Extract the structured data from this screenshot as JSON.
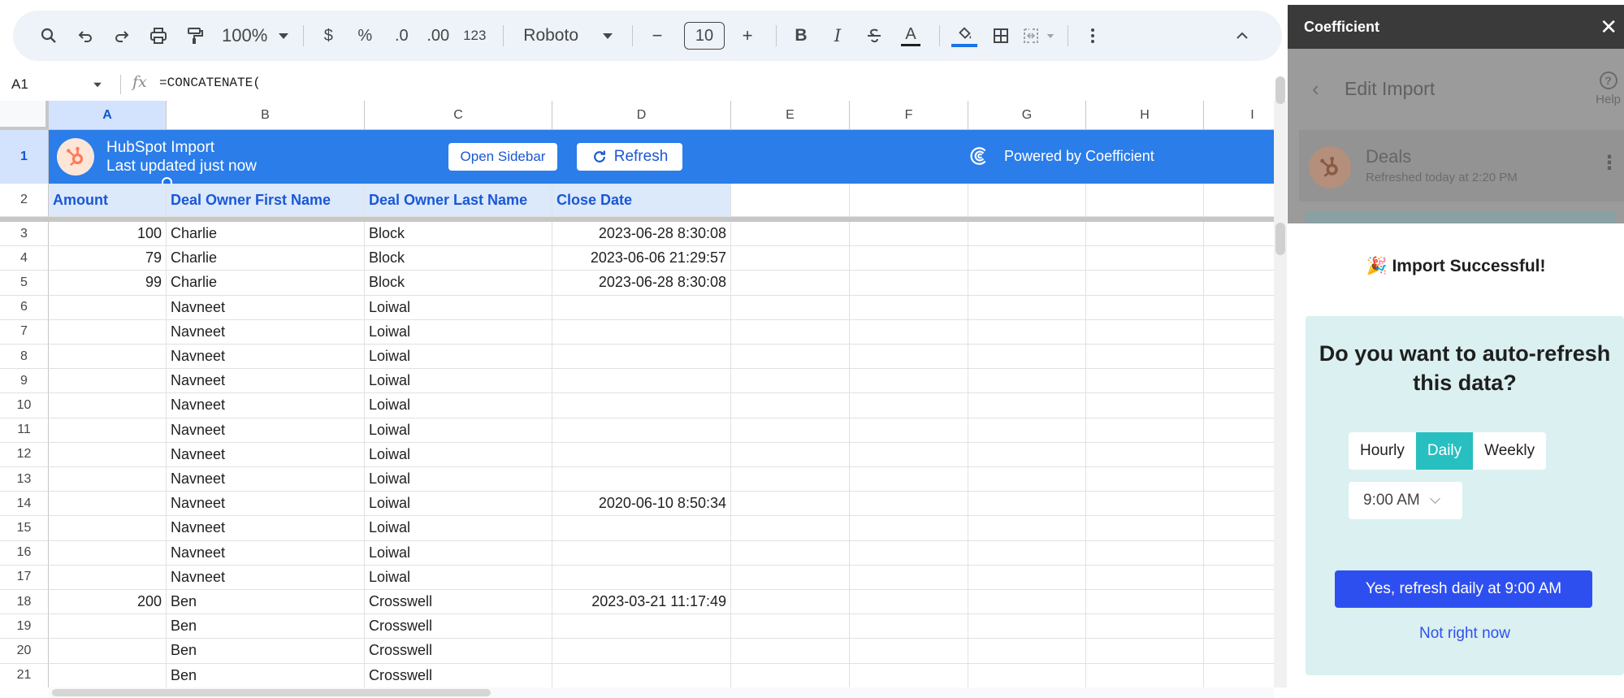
{
  "toolbar": {
    "zoom": "100%",
    "currency": "$",
    "percent": "%",
    "decrease_decimals": ".0",
    "increase_decimals": ".00",
    "more_formats": "123",
    "font": "Roboto",
    "font_size": "10",
    "minus": "−",
    "plus": "+",
    "bold": "B",
    "italic": "I",
    "text_color": "A"
  },
  "formula_bar": {
    "cell_ref": "A1",
    "fx": "fx",
    "formula": "=CONCATENATE("
  },
  "columns": [
    "A",
    "B",
    "C",
    "D",
    "E",
    "F",
    "G",
    "H",
    "I"
  ],
  "row_numbers": [
    "1",
    "2",
    "3",
    "4",
    "5",
    "6",
    "7",
    "8",
    "9",
    "10",
    "11",
    "12",
    "13",
    "14",
    "15",
    "16",
    "17",
    "18",
    "19",
    "20",
    "21"
  ],
  "banner": {
    "title": "HubSpot Import",
    "subtitle": "Last updated just now",
    "open_sidebar": "Open Sidebar",
    "refresh": "Refresh",
    "powered_by": "Powered by Coefficient"
  },
  "headers": [
    "Amount",
    "Deal Owner First Name",
    "Deal Owner Last Name",
    "Close Date"
  ],
  "rows": [
    [
      "100",
      "Charlie",
      "Block",
      "2023-06-28 8:30:08"
    ],
    [
      "79",
      "Charlie",
      "Block",
      "2023-06-06 21:29:57"
    ],
    [
      "99",
      "Charlie",
      "Block",
      "2023-06-28 8:30:08"
    ],
    [
      "",
      "Navneet",
      "Loiwal",
      ""
    ],
    [
      "",
      "Navneet",
      "Loiwal",
      ""
    ],
    [
      "",
      "Navneet",
      "Loiwal",
      ""
    ],
    [
      "",
      "Navneet",
      "Loiwal",
      ""
    ],
    [
      "",
      "Navneet",
      "Loiwal",
      ""
    ],
    [
      "",
      "Navneet",
      "Loiwal",
      ""
    ],
    [
      "",
      "Navneet",
      "Loiwal",
      ""
    ],
    [
      "",
      "Navneet",
      "Loiwal",
      ""
    ],
    [
      "",
      "Navneet",
      "Loiwal",
      "2020-06-10 8:50:34"
    ],
    [
      "",
      "Navneet",
      "Loiwal",
      ""
    ],
    [
      "",
      "Navneet",
      "Loiwal",
      ""
    ],
    [
      "",
      "Navneet",
      "Loiwal",
      ""
    ],
    [
      "200",
      "Ben",
      "Crosswell",
      "2023-03-21 11:17:49"
    ],
    [
      "",
      "Ben",
      "Crosswell",
      ""
    ],
    [
      "",
      "Ben",
      "Crosswell",
      ""
    ],
    [
      "",
      "Ben",
      "Crosswell",
      ""
    ]
  ],
  "panel": {
    "title": "Coefficient",
    "edit_import": "Edit Import",
    "help": "Help",
    "source_name": "Deals",
    "source_refreshed": "Refreshed today at 2:20 PM",
    "success": "🎉 Import Successful!",
    "question": "Do you want to auto-refresh this data?",
    "frequency_options": [
      "Hourly",
      "Daily",
      "Weekly"
    ],
    "frequency_selected": "Daily",
    "time": "9:00 AM",
    "confirm": "Yes, refresh daily at 9:00 AM",
    "decline": "Not right now"
  },
  "colors": {
    "banner": "#2b7de9",
    "accent_teal": "#27bfc0",
    "primary_button": "#2e4ff0",
    "card_bg": "#dbf0f0",
    "hubspot_orange": "#ff7a59"
  }
}
